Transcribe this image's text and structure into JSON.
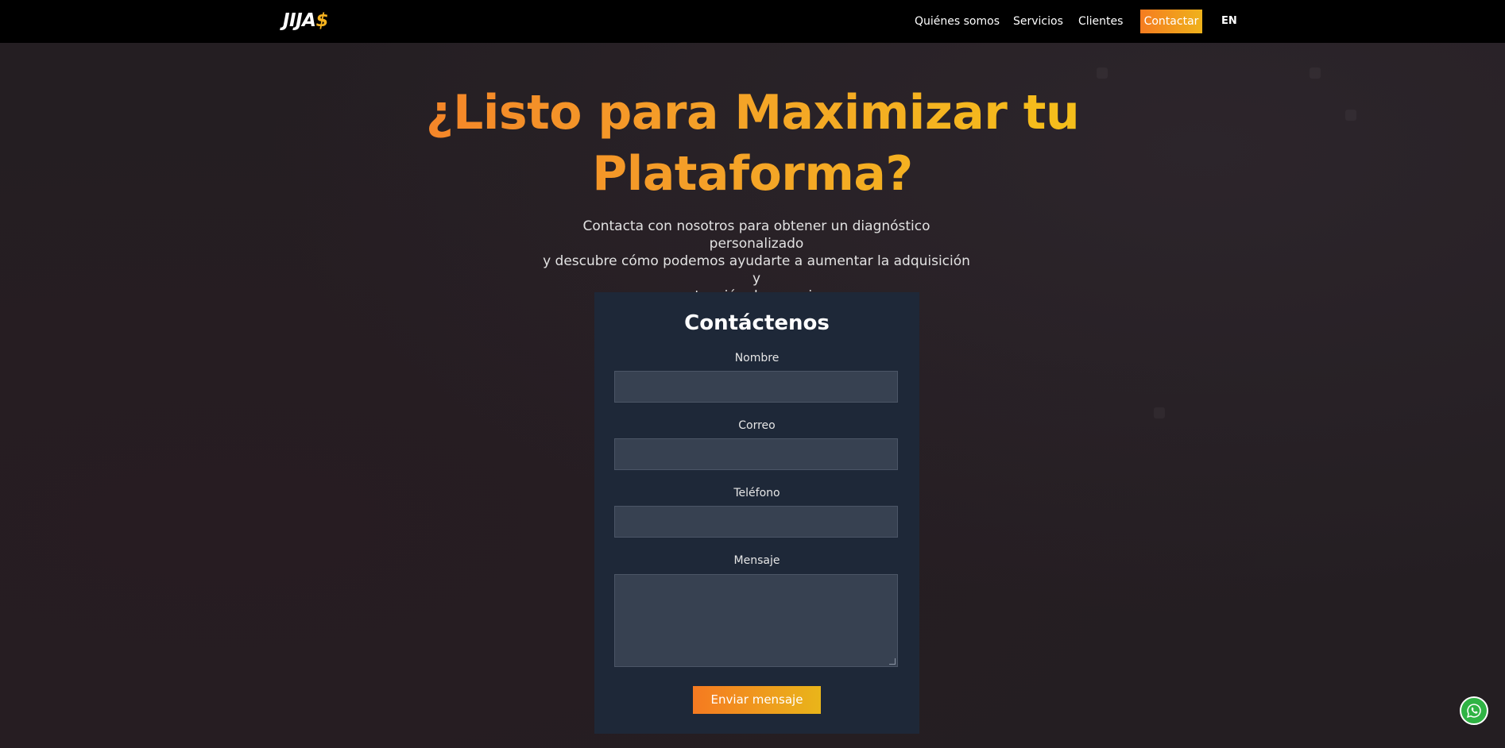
{
  "logo": {
    "main": "JIJA",
    "accent": "$"
  },
  "nav": {
    "items": [
      "Quiénes somos",
      "Servicios",
      "Clientes"
    ],
    "cta": "Contactar",
    "lang": "EN"
  },
  "hero": {
    "title_line1": "¿Listo para Maximizar tu",
    "title_line2": "Plataforma?",
    "subtitle_line1": "Contacta con nosotros para obtener un diagnóstico personalizado",
    "subtitle_line2": "y descubre cómo podemos ayudarte a aumentar la adquisición y",
    "subtitle_line3": "retención de usuarios."
  },
  "form": {
    "title": "Contáctenos",
    "fields": {
      "nombre": {
        "label": "Nombre",
        "value": ""
      },
      "correo": {
        "label": "Correo",
        "value": ""
      },
      "telefono": {
        "label": "Teléfono",
        "value": ""
      },
      "mensaje": {
        "label": "Mensaje",
        "value": ""
      }
    },
    "submit_label": "Enviar mensaje"
  },
  "colors": {
    "accent_orange": "#f57c20",
    "accent_yellow": "#f5c518",
    "navbar_bg": "#000000",
    "page_bg": "#241e22",
    "card_bg": "#1e2838",
    "whatsapp": "#2fb344"
  },
  "icons": {
    "floating": "whatsapp-icon"
  }
}
